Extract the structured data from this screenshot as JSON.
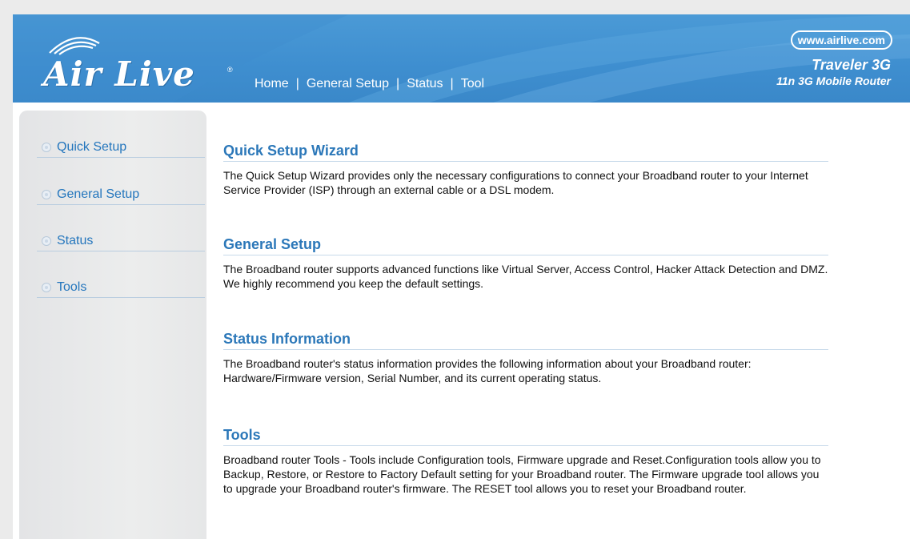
{
  "header": {
    "brand": "Air Live",
    "registered": "®",
    "nav": [
      {
        "label": "Home"
      },
      {
        "label": "General Setup"
      },
      {
        "label": "Status"
      },
      {
        "label": "Tool"
      }
    ],
    "separator": "|",
    "url": "www.airlive.com",
    "model": "Traveler 3G",
    "model_desc": "11n 3G Mobile Router"
  },
  "sidebar": {
    "items": [
      {
        "label": "Quick Setup"
      },
      {
        "label": "General Setup"
      },
      {
        "label": "Status"
      },
      {
        "label": "Tools"
      }
    ]
  },
  "main": {
    "sections": [
      {
        "title": "Quick Setup Wizard",
        "text": "The Quick Setup Wizard provides only the necessary configurations to connect your Broadband router to your Internet Service Provider (ISP) through an external cable or a DSL modem."
      },
      {
        "title": "General Setup",
        "text": "The Broadband router supports advanced functions like Virtual Server, Access Control, Hacker Attack Detection and DMZ. We highly recommend you keep the default settings."
      },
      {
        "title": "Status Information",
        "text": "The Broadband router's status information provides the following information about your Broadband router: Hardware/Firmware version, Serial Number, and its current operating status."
      },
      {
        "title": "Tools",
        "text": "Broadband router Tools - Tools include Configuration tools, Firmware upgrade and Reset.Configuration tools allow you to Backup, Restore, or Restore to Factory Default setting for your Broadband router. The Firmware upgrade tool allows you to upgrade your Broadband router's firmware. The RESET tool allows you to reset your Broadband router."
      }
    ]
  },
  "colors": {
    "header_blue": "#4b9ad6",
    "heading_blue": "#2c78b9",
    "link_blue": "#2476bd",
    "sidebar_gray": "#e6e7e8"
  }
}
